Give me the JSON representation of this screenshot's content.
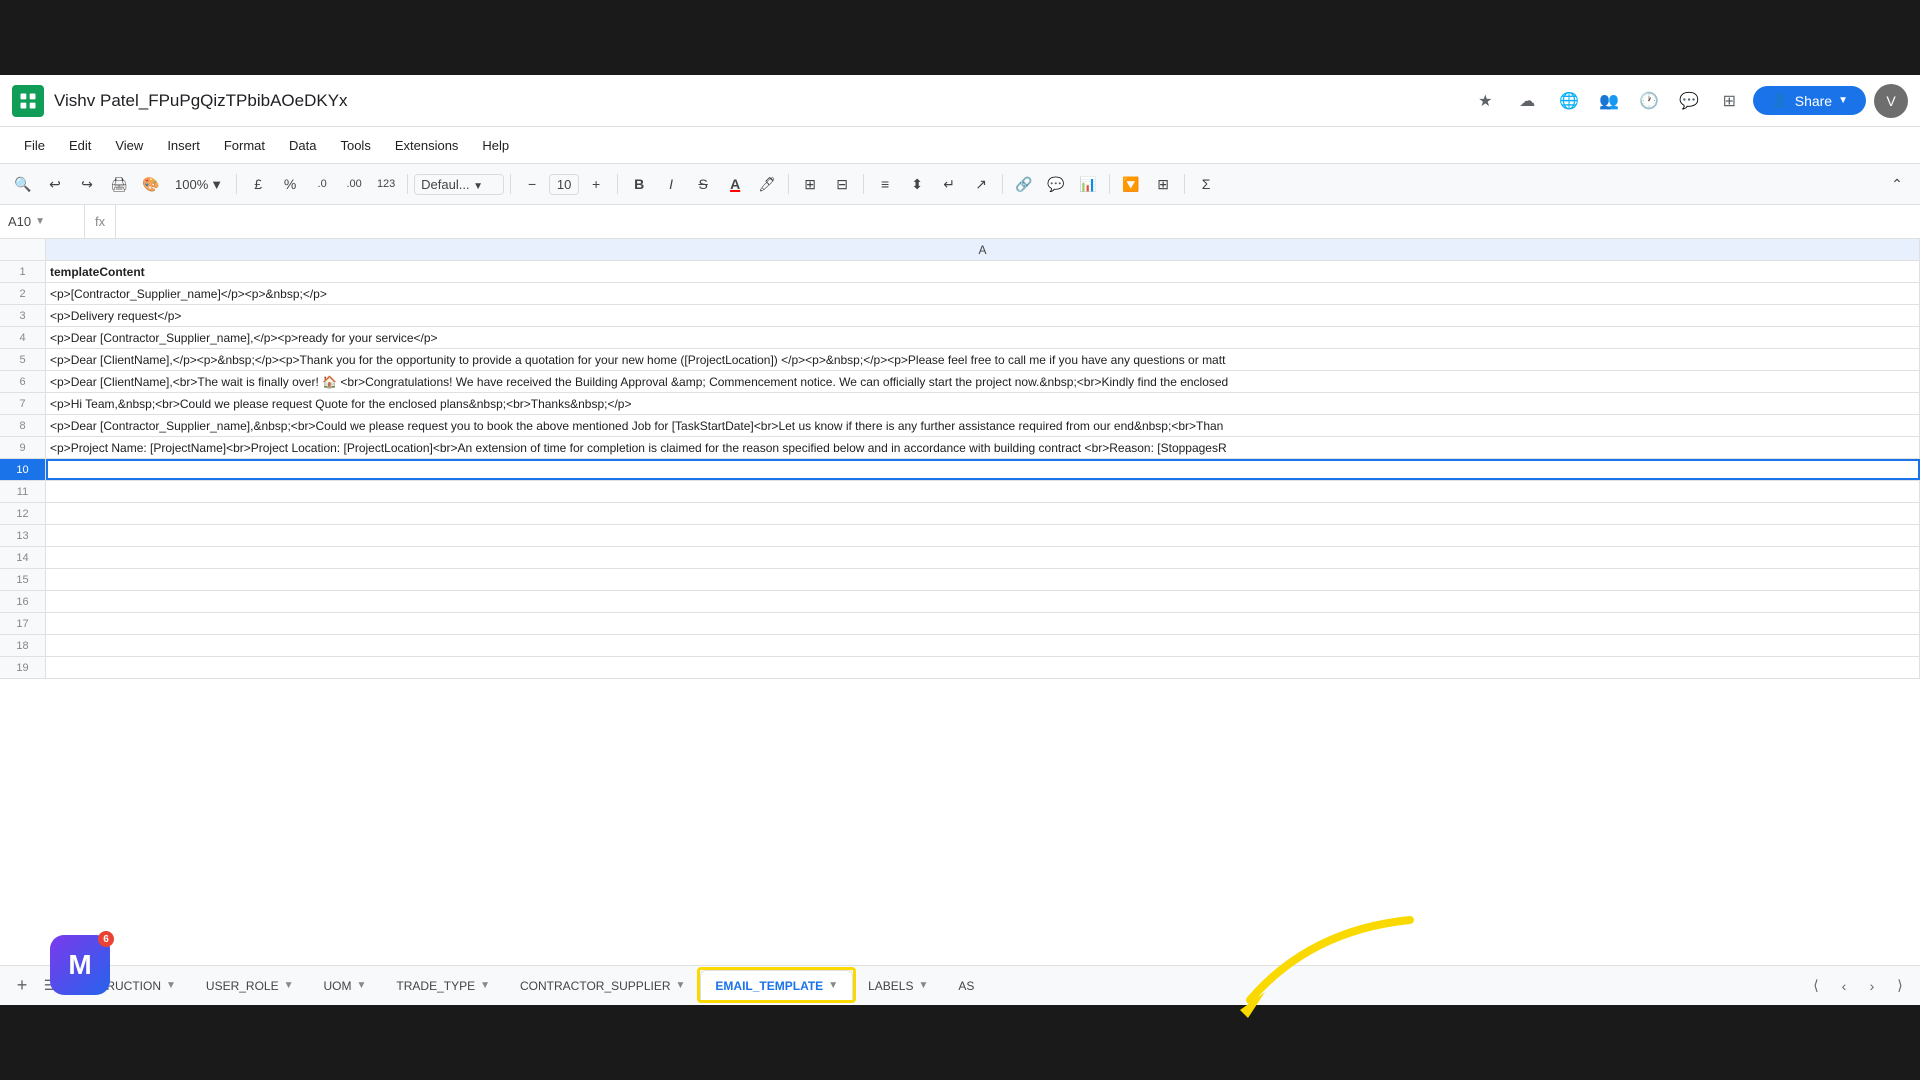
{
  "title": {
    "filename": "Vishv Patel_FPuPgQizTPbibAOeDKYx",
    "star": "★",
    "cloud": "☁"
  },
  "menu": {
    "items": [
      "File",
      "Edit",
      "View",
      "Insert",
      "Format",
      "Data",
      "Tools",
      "Extensions",
      "Help"
    ]
  },
  "toolbar": {
    "zoom": "100%",
    "currency": "£",
    "percent": "%",
    "decimal_decrease": ".0",
    "decimal_increase": ".00",
    "format_number": "123",
    "font": "Defaul...",
    "font_size": "10",
    "bold": "B",
    "italic": "I",
    "strikethrough": "S"
  },
  "formula_bar": {
    "cell_ref": "A10",
    "function_icon": "fx",
    "content": ""
  },
  "columns": {
    "header": "A"
  },
  "rows": [
    {
      "num": 1,
      "content": "templateContent",
      "is_header": true
    },
    {
      "num": 2,
      "content": "<p>[Contractor_Supplier_name]</p><p>&nbsp;</p>"
    },
    {
      "num": 3,
      "content": "<p>Delivery request</p>"
    },
    {
      "num": 4,
      "content": "<p>Dear [Contractor_Supplier_name],</p><p>ready for your service</p>"
    },
    {
      "num": 5,
      "content": "<p>Dear [ClientName],</p><p>&nbsp;</p><p>Thank you for the opportunity to provide a quotation for your new home ([ProjectLocation]) </p><p>&nbsp;</p><p>Please feel free to call me if you have any questions or matt"
    },
    {
      "num": 6,
      "content": "<p>Dear [ClientName],<br>The wait is finally over! 🏠 <br>Congratulations! We have received the Building Approval &amp; Commencement notice. We can officially start the project now.&nbsp;<br>Kindly find the enclosed"
    },
    {
      "num": 7,
      "content": "<p>Hi Team,&nbsp;<br>Could we please request Quote for the enclosed plans&nbsp;<br>Thanks&nbsp;</p>"
    },
    {
      "num": 8,
      "content": "<p>Dear [Contractor_Supplier_name],&nbsp;<br>Could we please request you to book the above mentioned Job for [TaskStartDate]<br>Let us know if there is any further assistance required from our end&nbsp;<br>Than"
    },
    {
      "num": 9,
      "content": "<p>Project Name: [ProjectName]<br>Project Location: [ProjectLocation]<br>An extension of time for completion is claimed for the reason specified below and in accordance with building contract <br>Reason: [StoppagesR"
    },
    {
      "num": 10,
      "content": "",
      "is_active": true
    },
    {
      "num": 11,
      "content": ""
    },
    {
      "num": 12,
      "content": ""
    },
    {
      "num": 13,
      "content": ""
    },
    {
      "num": 14,
      "content": ""
    },
    {
      "num": 15,
      "content": ""
    },
    {
      "num": 16,
      "content": ""
    },
    {
      "num": 17,
      "content": ""
    },
    {
      "num": 18,
      "content": ""
    },
    {
      "num": 19,
      "content": ""
    }
  ],
  "tabs": [
    {
      "id": "instruction",
      "label": "INSTRUCTION",
      "active": false
    },
    {
      "id": "user_role",
      "label": "USER_ROLE",
      "active": false
    },
    {
      "id": "uom",
      "label": "UOM",
      "active": false
    },
    {
      "id": "trade_type",
      "label": "TRADE_TYPE",
      "active": false
    },
    {
      "id": "contractor_supplier",
      "label": "CONTRACTOR_SUPPLIER",
      "active": false
    },
    {
      "id": "email_template",
      "label": "EMAIL_TEMPLATE",
      "active": true
    },
    {
      "id": "labels",
      "label": "LABELS",
      "active": false
    },
    {
      "id": "as",
      "label": "AS",
      "active": false
    }
  ],
  "share": {
    "label": "Share"
  },
  "notification": {
    "count": "6"
  },
  "colors": {
    "yellow_highlight": "#f9d900",
    "active_tab_text": "#1a73e8",
    "sheets_green": "#0f9d58",
    "active_blue": "#1a73e8"
  }
}
